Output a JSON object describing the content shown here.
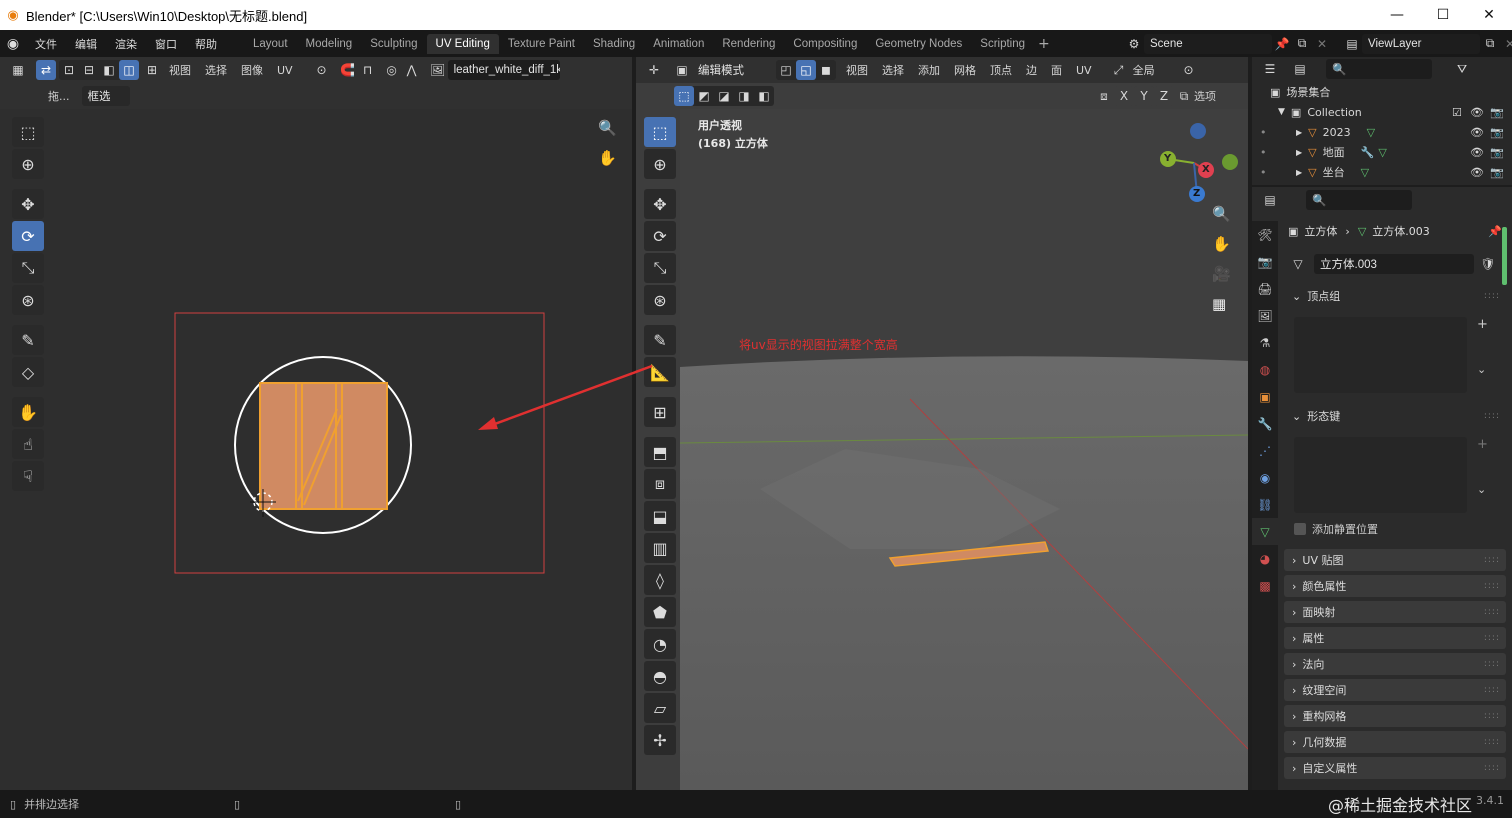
{
  "window": {
    "title": "Blender* [C:\\Users\\Win10\\Desktop\\无标题.blend]",
    "controls": [
      "—",
      "☐",
      "✕"
    ]
  },
  "menubar": {
    "items": [
      "文件",
      "编辑",
      "渲染",
      "窗口",
      "帮助"
    ],
    "workspaces": [
      "Layout",
      "Modeling",
      "Sculpting",
      "UV Editing",
      "Texture Paint",
      "Shading",
      "Animation",
      "Rendering",
      "Compositing",
      "Geometry Nodes",
      "Scripting"
    ],
    "active_workspace": "UV Editing",
    "scene": "Scene",
    "view_layer": "ViewLayer"
  },
  "uv_editor": {
    "menu": [
      "视图",
      "选择",
      "图像",
      "UV"
    ],
    "image_name": "leather_white_diff_1k",
    "sub_left": "拖...",
    "sub_select": "框选"
  },
  "viewport": {
    "mode": "编辑模式",
    "menu": [
      "视图",
      "选择",
      "添加",
      "网格",
      "顶点",
      "边",
      "面",
      "UV"
    ],
    "transform": "全局",
    "axes": [
      "X",
      "Y",
      "Z"
    ],
    "options": "选项",
    "overlay_line1": "用户透视",
    "overlay_line2": "(168) 立方体",
    "annotation": "将uv显示的视图拉满整个宽高",
    "gizmo": {
      "x": "X",
      "y": "Y",
      "z": "Z"
    }
  },
  "outliner": {
    "root": "场景集合",
    "collection": "Collection",
    "items": [
      "2023",
      "地面",
      "坐台"
    ]
  },
  "properties": {
    "object": "立方体",
    "mesh": "立方体.003",
    "datablock": "立方体.003",
    "sections": {
      "vertex_groups": "顶点组",
      "shape_keys": "形态键",
      "add_rest": "添加静置位置",
      "uv_maps": "UV 贴图",
      "color_attrs": "颜色属性",
      "face_maps": "面映射",
      "attributes": "属性",
      "normals": "法向",
      "texture_space": "纹理空间",
      "remesh": "重构网格",
      "geometry_data": "几何数据",
      "custom_props": "自定义属性"
    }
  },
  "status": {
    "left": "并排边选择",
    "version": "3.4.1",
    "watermark": "@稀土掘金技术社区"
  },
  "colors": {
    "accent": "#4772b3",
    "selection_orange": "#f0a030",
    "annotation_red": "#e03030"
  }
}
